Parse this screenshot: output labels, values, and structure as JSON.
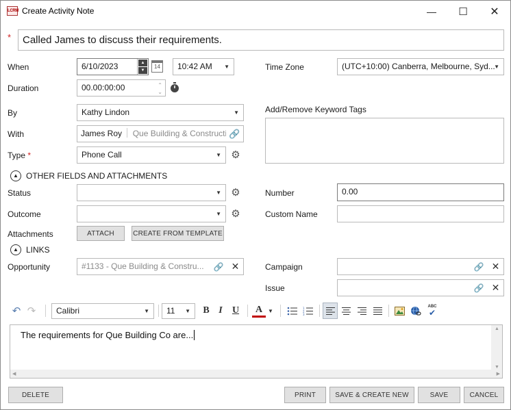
{
  "window": {
    "icon_text": "LCRM",
    "title": "Create Activity Note",
    "minimize": "—",
    "maximize": "☐",
    "close": "✕"
  },
  "subject": {
    "required_marker": "*",
    "value": "Called James to discuss their requirements."
  },
  "when": {
    "label": "When",
    "date": "6/10/2023",
    "time": "10:42 AM",
    "calendar_day": "14"
  },
  "duration": {
    "label": "Duration",
    "value": "00.00:00:00"
  },
  "time_zone": {
    "label": "Time Zone",
    "value": "(UTC+10:00) Canberra, Melbourne, Syd..."
  },
  "by": {
    "label": "By",
    "value": "Kathy Lindon"
  },
  "with": {
    "label": "With",
    "contact": "James Roy",
    "company": "Que Building & Constructic"
  },
  "type": {
    "label": "Type",
    "required_marker": "*",
    "value": "Phone Call"
  },
  "keyword_tags": {
    "label": "Add/Remove Keyword Tags"
  },
  "other_fields": {
    "label": "OTHER FIELDS AND ATTACHMENTS"
  },
  "status": {
    "label": "Status",
    "value": ""
  },
  "outcome": {
    "label": "Outcome",
    "value": ""
  },
  "number": {
    "label": "Number",
    "value": "0.00"
  },
  "custom_name": {
    "label": "Custom Name",
    "value": ""
  },
  "attachments": {
    "label": "Attachments",
    "attach_button": "ATTACH",
    "template_button": "CREATE FROM TEMPLATE"
  },
  "links": {
    "label": "LINKS",
    "opportunity_label": "Opportunity",
    "opportunity_value": "#1133 - Que Building & Constru...",
    "campaign_label": "Campaign",
    "campaign_value": "",
    "issue_label": "Issue",
    "issue_value": ""
  },
  "toolbar": {
    "font": "Calibri",
    "size": "11",
    "bold": "B",
    "italic": "I",
    "underline": "U",
    "font_color": "A",
    "spellcheck": "ABC"
  },
  "editor": {
    "text": "The requirements for Que Building Co are..."
  },
  "footer": {
    "delete": "DELETE",
    "print": "PRINT",
    "save_create_new": "SAVE & CREATE NEW",
    "save": "SAVE",
    "cancel": "CANCEL"
  },
  "colors": {
    "required": "#d02020",
    "button_bg": "#e1e1e1",
    "border": "#b9b9b9",
    "font_color_bar": "#c00000"
  }
}
